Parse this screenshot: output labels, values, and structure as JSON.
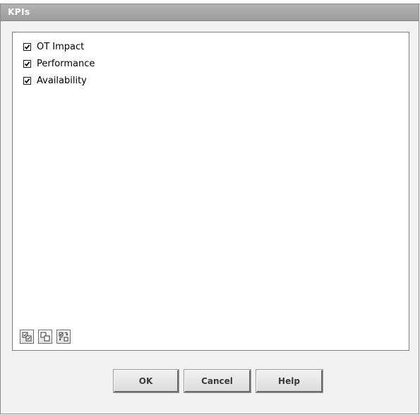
{
  "dialog": {
    "title": "KPIs"
  },
  "kpi_list": {
    "items": [
      {
        "label": "OT Impact",
        "checked": true
      },
      {
        "label": "Performance",
        "checked": true
      },
      {
        "label": "Availability",
        "checked": true
      }
    ]
  },
  "toolbar": {
    "tools": [
      {
        "icon": "select-all-icon"
      },
      {
        "icon": "clear-all-icon"
      },
      {
        "icon": "invert-selection-icon"
      }
    ]
  },
  "buttons": {
    "ok_label": "OK",
    "cancel_label": "Cancel",
    "help_label": "Help"
  }
}
